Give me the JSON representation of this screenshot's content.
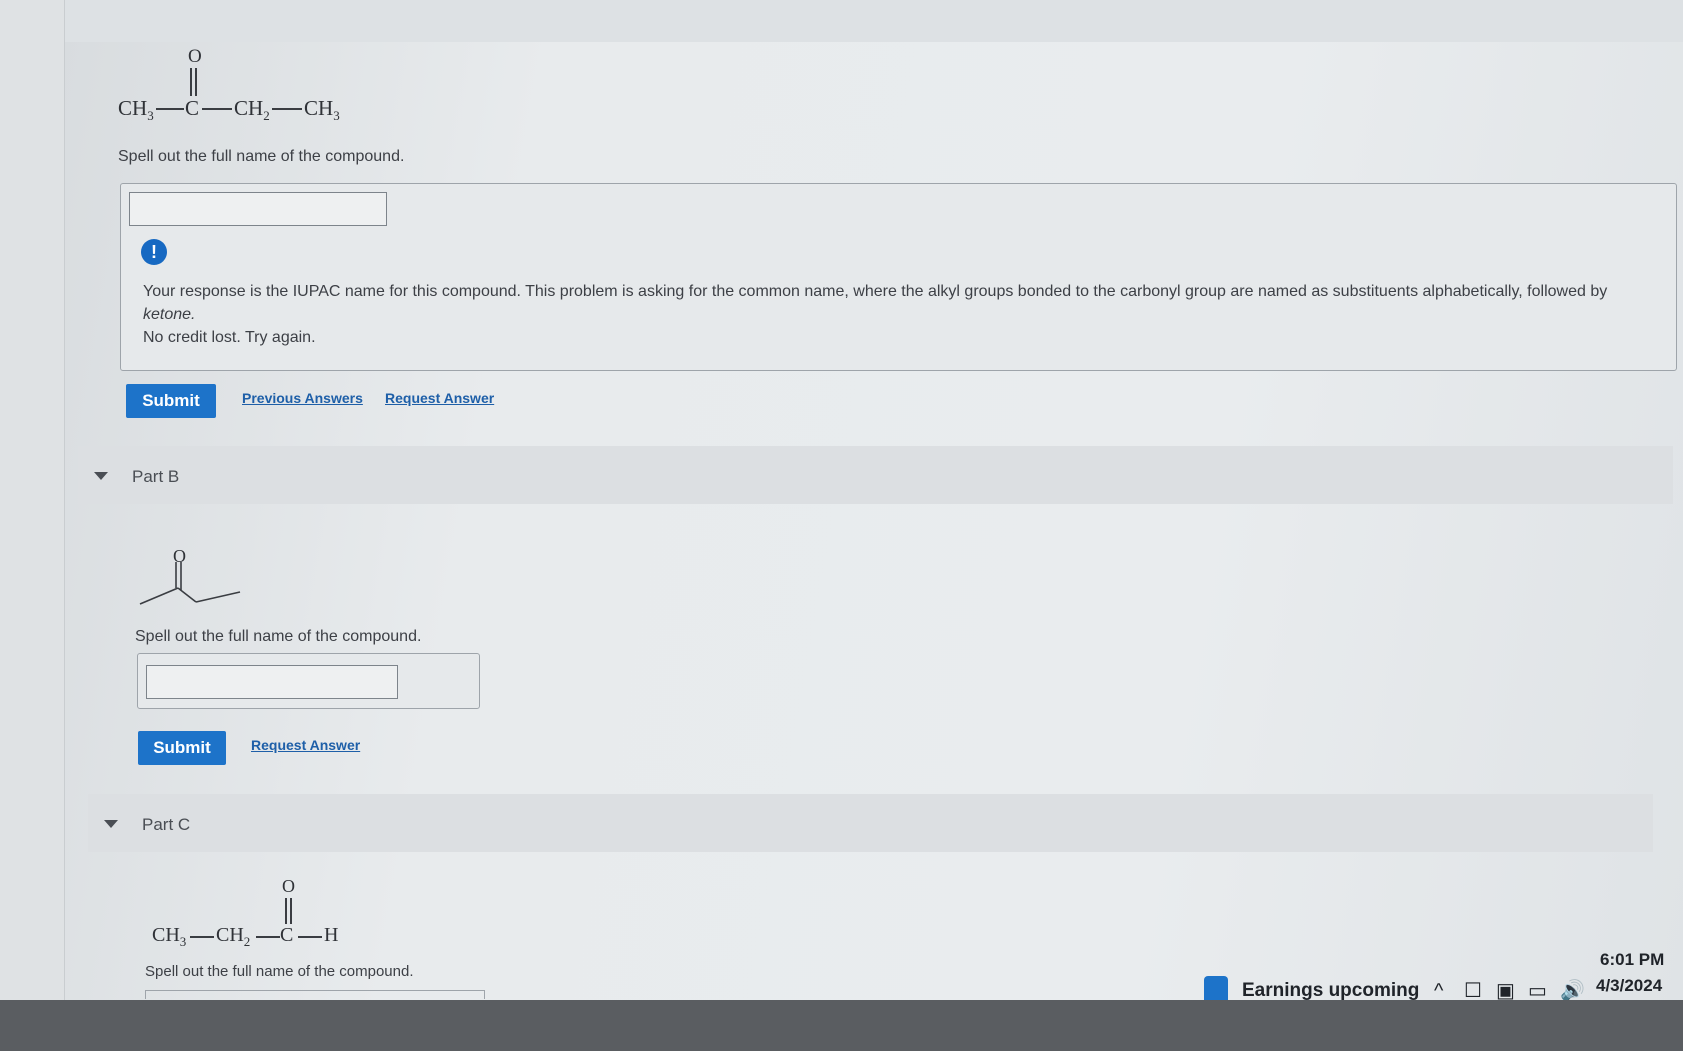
{
  "partA": {
    "formula": {
      "o": "O",
      "left": "CH",
      "c": "C",
      "mid": "CH",
      "right": "CH",
      "sub3": "3",
      "sub2": "2"
    },
    "prompt": "Spell out the full name of the compound.",
    "input_value": "",
    "feedback_line1": "Your response is the IUPAC name for this compound. This problem is asking for the common name, where the alkyl groups bonded to the carbonyl group are named as substituents alphabetically, followed by",
    "feedback_em": "ketone.",
    "feedback_line2": "No credit lost. Try again.",
    "submit_label": "Submit",
    "previous_answers": "Previous Answers",
    "request_answer": "Request Answer"
  },
  "partB": {
    "label": "Part B",
    "o": "O",
    "prompt": "Spell out the full name of the compound.",
    "input_value": "",
    "submit_label": "Submit",
    "request_answer": "Request Answer"
  },
  "partC": {
    "label": "Part C",
    "formula": {
      "o": "O",
      "ch3": "CH",
      "ch2": "CH",
      "c": "C",
      "h": "H",
      "sub3": "3",
      "sub2": "2"
    },
    "prompt": "Spell out the full name of the compound."
  },
  "taskbar": {
    "news": "Earnings upcoming",
    "time": "6:01 PM",
    "date": "4/3/2024"
  },
  "colors": {
    "accent": "#1d73c9",
    "link": "#1e5fa8",
    "alert": "#1769c2"
  }
}
